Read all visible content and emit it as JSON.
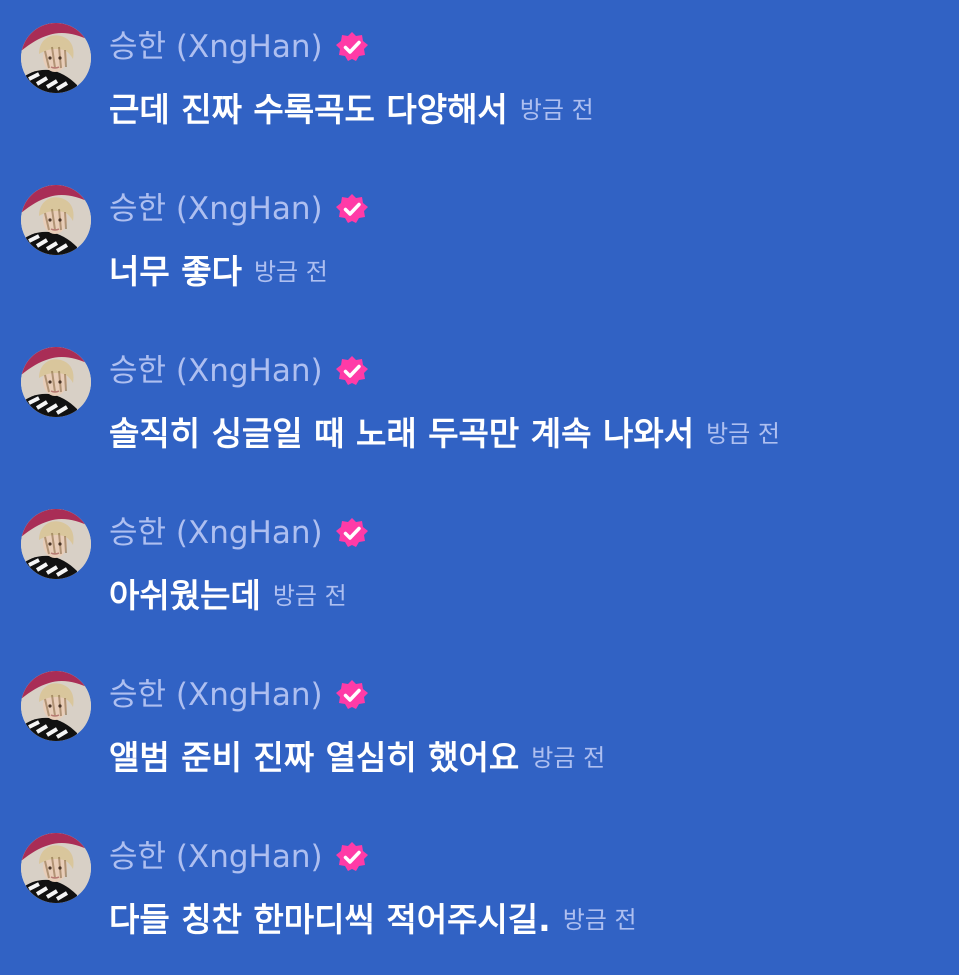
{
  "colors": {
    "background": "#3162c4",
    "author_text": "#aebff0",
    "message_text": "#ffffff",
    "timestamp_text": "#aebff0",
    "verified_badge": "#ff3ba7"
  },
  "messages": [
    {
      "author": "승한 (XngHan)",
      "text": "근데 진짜 수록곡도 다양해서",
      "time": "방금 전",
      "verified_icon": "verified-badge-icon",
      "avatar": "avatar-image"
    },
    {
      "author": "승한 (XngHan)",
      "text": "너무 좋다",
      "time": "방금 전",
      "verified_icon": "verified-badge-icon",
      "avatar": "avatar-image"
    },
    {
      "author": "승한 (XngHan)",
      "text": "솔직히 싱글일 때 노래 두곡만 계속 나와서",
      "time": "방금 전",
      "verified_icon": "verified-badge-icon",
      "avatar": "avatar-image"
    },
    {
      "author": "승한 (XngHan)",
      "text": "아쉬웠는데",
      "time": "방금 전",
      "verified_icon": "verified-badge-icon",
      "avatar": "avatar-image"
    },
    {
      "author": "승한 (XngHan)",
      "text": "앨범 준비 진짜 열심히 했어요",
      "time": "방금 전",
      "verified_icon": "verified-badge-icon",
      "avatar": "avatar-image"
    },
    {
      "author": "승한 (XngHan)",
      "text": "다들 칭찬 한마디씩 적어주시길.",
      "time": "방금 전",
      "verified_icon": "verified-badge-icon",
      "avatar": "avatar-image"
    }
  ]
}
